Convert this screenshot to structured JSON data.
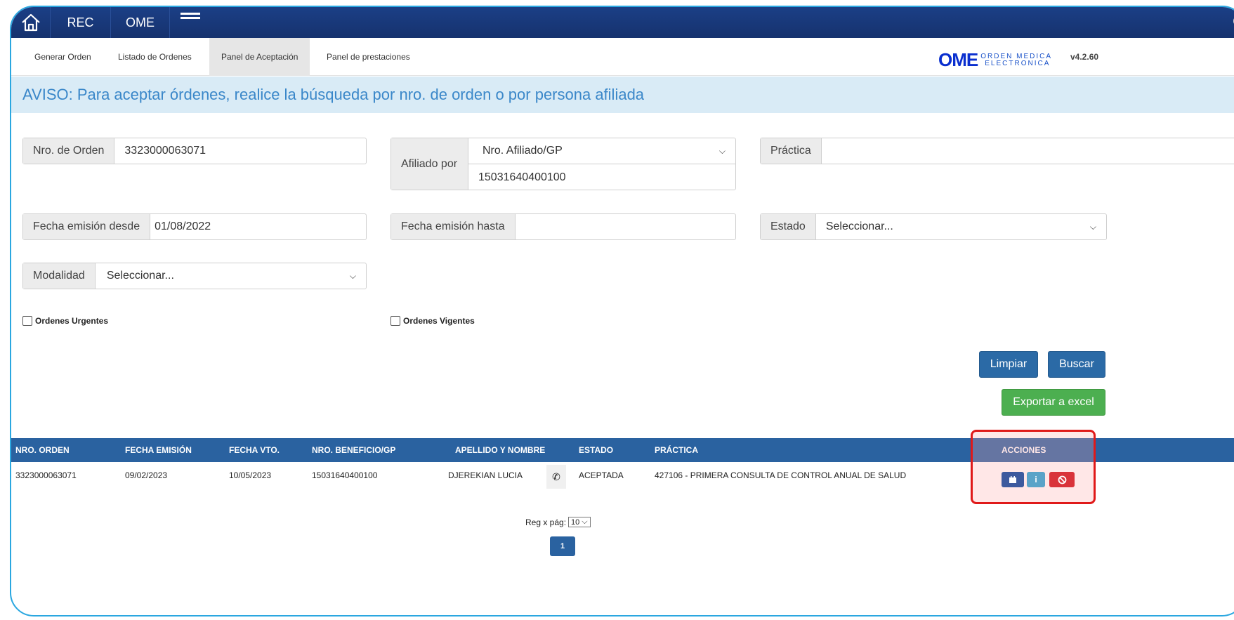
{
  "topbar": {
    "rec": "REC",
    "ome": "OME"
  },
  "nav": {
    "tabs": [
      {
        "label": "Generar Orden"
      },
      {
        "label": "Listado de Ordenes"
      },
      {
        "label": "Panel de Aceptación",
        "active": true
      },
      {
        "label": "Panel de prestaciones"
      }
    ],
    "brand_main": "OME",
    "brand_line1": "ORDEN MEDICA",
    "brand_line2": "ELECTRONICA",
    "version": "v4.2.60"
  },
  "notice": "AVISO: Para aceptar órdenes, realice la búsqueda por nro. de orden o por persona afiliada",
  "form": {
    "nro_orden": {
      "label": "Nro. de Orden",
      "value": "3323000063071"
    },
    "afiliado": {
      "label": "Afiliado por",
      "select_value": "Nro. Afiliado/GP",
      "value": "15031640400100"
    },
    "practica": {
      "label": "Práctica",
      "value": ""
    },
    "fecha_desde": {
      "label": "Fecha emisión desde",
      "value": "01/08/2022"
    },
    "fecha_hasta": {
      "label": "Fecha emisión hasta",
      "value": ""
    },
    "estado": {
      "label": "Estado",
      "value": "Seleccionar..."
    },
    "modalidad": {
      "label": "Modalidad",
      "value": "Seleccionar..."
    },
    "urgentes": {
      "label": "Ordenes Urgentes",
      "checked": false
    },
    "vigentes": {
      "label": "Ordenes Vigentes",
      "checked": false
    }
  },
  "buttons": {
    "limpiar": "Limpiar",
    "buscar": "Buscar",
    "exportar": "Exportar a excel"
  },
  "table": {
    "headers": [
      "NRO. ORDEN",
      "FECHA EMISIÓN",
      "FECHA VTO.",
      "NRO. BENEFICIO/GP",
      "APELLIDO Y NOMBRE",
      "ESTADO",
      "PRÁCTICA",
      "ACCIONES"
    ],
    "rows": [
      [
        "3323000063071",
        "09/02/2023",
        "10/05/2023",
        "15031640400100",
        "DJEREKIAN LUCIA",
        "ACEPTADA",
        "427106 - PRIMERA CONSULTA DE CONTROL ANUAL DE SALUD"
      ]
    ],
    "actions": [
      {
        "icon": "calendar-icon",
        "color": "#3d5a9e"
      },
      {
        "icon": "info-icon",
        "color": "#5aa3c8"
      },
      {
        "icon": "ban-icon",
        "color": "#d9333a"
      }
    ]
  },
  "pagination": {
    "reg_label": "Reg x pág:",
    "per_page": "10",
    "current_page": "1"
  },
  "colors": {
    "header_bar": "#1b3f86",
    "table_header": "#2a62a0",
    "notice_bg": "#d9ebf6",
    "export_green": "#4caf50",
    "highlight_red": "#e01919"
  }
}
